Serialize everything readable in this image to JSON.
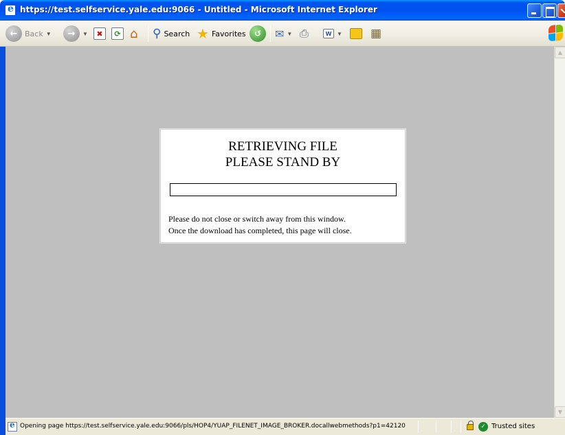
{
  "window": {
    "title": "https://test.selfservice.yale.edu:9066 - Untitled - Microsoft Internet Explorer"
  },
  "toolbar": {
    "back_label": "Back",
    "search_label": "Search",
    "favorites_label": "Favorites",
    "icons": [
      "back-icon",
      "forward-icon",
      "stop-icon",
      "refresh-icon",
      "home-icon",
      "search-icon",
      "favorites-star-icon",
      "history-icon",
      "mail-icon",
      "print-icon",
      "edit-icon",
      "notes-icon",
      "research-icon"
    ]
  },
  "dialog": {
    "heading_line1": "RETRIEVING FILE",
    "heading_line2": "PLEASE STAND BY",
    "progress": 0,
    "message_line1": "Please do not close or switch away from this window.",
    "message_line2": "Once the download has completed, this page will close."
  },
  "statusbar": {
    "text": "Opening page https://test.selfservice.yale.edu:9066/pls/HOP4/YUAP_FILENET_IMAGE_BROKER.docallwebmethods?p1=42120",
    "zone": "Trusted sites"
  },
  "colors": {
    "titlebar": "#0054e3",
    "content_background": "#bfbfbf",
    "dialog_background": "#ffffff",
    "progress_fill": "#000080"
  }
}
